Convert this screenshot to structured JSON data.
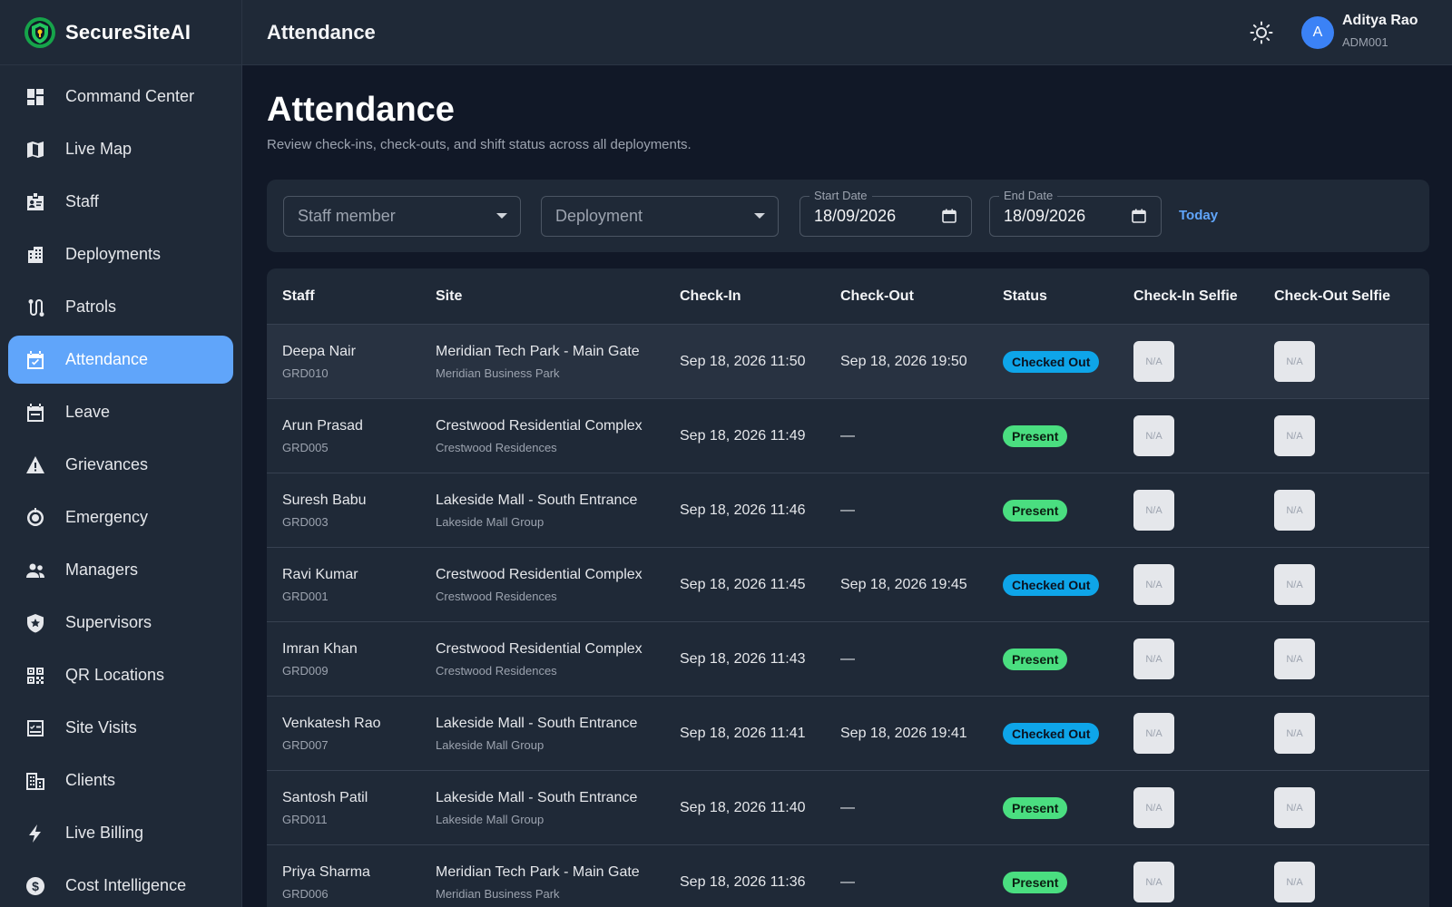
{
  "app": {
    "name": "SecureSiteAI"
  },
  "sidebar": {
    "items": [
      {
        "label": "Command Center",
        "icon": "dashboard-icon",
        "active": false
      },
      {
        "label": "Live Map",
        "icon": "map-icon",
        "active": false
      },
      {
        "label": "Staff",
        "icon": "id-badge-icon",
        "active": false
      },
      {
        "label": "Deployments",
        "icon": "building-icon",
        "active": false
      },
      {
        "label": "Patrols",
        "icon": "route-icon",
        "active": false
      },
      {
        "label": "Attendance",
        "icon": "calendar-check-icon",
        "active": true
      },
      {
        "label": "Leave",
        "icon": "calendar-icon",
        "active": false
      },
      {
        "label": "Grievances",
        "icon": "warning-icon",
        "active": false
      },
      {
        "label": "Emergency",
        "icon": "emergency-icon",
        "active": false
      },
      {
        "label": "Managers",
        "icon": "people-icon",
        "active": false
      },
      {
        "label": "Supervisors",
        "icon": "shield-star-icon",
        "active": false
      },
      {
        "label": "QR Locations",
        "icon": "qr-code-icon",
        "active": false
      },
      {
        "label": "Site Visits",
        "icon": "checklist-icon",
        "active": false
      },
      {
        "label": "Clients",
        "icon": "office-building-icon",
        "active": false
      },
      {
        "label": "Live Billing",
        "icon": "bolt-icon",
        "active": false
      },
      {
        "label": "Cost Intelligence",
        "icon": "dollar-circle-icon",
        "active": false
      }
    ]
  },
  "header": {
    "title": "Attendance",
    "user": {
      "initial": "A",
      "name": "Aditya Rao",
      "id": "ADM001"
    }
  },
  "page": {
    "title": "Attendance",
    "subtitle": "Review check-ins, check-outs, and shift status across all deployments."
  },
  "filters": {
    "staff_placeholder": "Staff member",
    "deployment_placeholder": "Deployment",
    "start_label": "Start Date",
    "start_value": "18/09/2026",
    "end_label": "End Date",
    "end_value": "18/09/2026",
    "today_label": "Today"
  },
  "table": {
    "headers": {
      "staff": "Staff",
      "site": "Site",
      "check_in": "Check-In",
      "check_out": "Check-Out",
      "status": "Status",
      "check_in_selfie": "Check-In Selfie",
      "check_out_selfie": "Check-Out Selfie"
    },
    "rows": [
      {
        "name": "Deepa Nair",
        "id": "GRD010",
        "site": "Meridian Tech Park - Main Gate",
        "client": "Meridian Business Park",
        "check_in": "Sep 18, 2026 11:50",
        "check_out": "Sep 18, 2026 19:50",
        "status": "Checked Out",
        "selfie_in": "N/A",
        "selfie_out": "N/A"
      },
      {
        "name": "Arun Prasad",
        "id": "GRD005",
        "site": "Crestwood Residential Complex",
        "client": "Crestwood Residences",
        "check_in": "Sep 18, 2026 11:49",
        "check_out": "—",
        "status": "Present",
        "selfie_in": "N/A",
        "selfie_out": "N/A"
      },
      {
        "name": "Suresh Babu",
        "id": "GRD003",
        "site": "Lakeside Mall - South Entrance",
        "client": "Lakeside Mall Group",
        "check_in": "Sep 18, 2026 11:46",
        "check_out": "—",
        "status": "Present",
        "selfie_in": "N/A",
        "selfie_out": "N/A"
      },
      {
        "name": "Ravi Kumar",
        "id": "GRD001",
        "site": "Crestwood Residential Complex",
        "client": "Crestwood Residences",
        "check_in": "Sep 18, 2026 11:45",
        "check_out": "Sep 18, 2026 19:45",
        "status": "Checked Out",
        "selfie_in": "N/A",
        "selfie_out": "N/A"
      },
      {
        "name": "Imran Khan",
        "id": "GRD009",
        "site": "Crestwood Residential Complex",
        "client": "Crestwood Residences",
        "check_in": "Sep 18, 2026 11:43",
        "check_out": "—",
        "status": "Present",
        "selfie_in": "N/A",
        "selfie_out": "N/A"
      },
      {
        "name": "Venkatesh Rao",
        "id": "GRD007",
        "site": "Lakeside Mall - South Entrance",
        "client": "Lakeside Mall Group",
        "check_in": "Sep 18, 2026 11:41",
        "check_out": "Sep 18, 2026 19:41",
        "status": "Checked Out",
        "selfie_in": "N/A",
        "selfie_out": "N/A"
      },
      {
        "name": "Santosh Patil",
        "id": "GRD011",
        "site": "Lakeside Mall - South Entrance",
        "client": "Lakeside Mall Group",
        "check_in": "Sep 18, 2026 11:40",
        "check_out": "—",
        "status": "Present",
        "selfie_in": "N/A",
        "selfie_out": "N/A"
      },
      {
        "name": "Priya Sharma",
        "id": "GRD006",
        "site": "Meridian Tech Park - Main Gate",
        "client": "Meridian Business Park",
        "check_in": "Sep 18, 2026 11:36",
        "check_out": "—",
        "status": "Present",
        "selfie_in": "N/A",
        "selfie_out": "N/A"
      }
    ]
  },
  "colors": {
    "accent": "#60a5fa",
    "checked_out": "#0ea5e9",
    "present": "#4ade80",
    "sidebar_bg": "#1f2937",
    "page_bg": "#111827"
  }
}
